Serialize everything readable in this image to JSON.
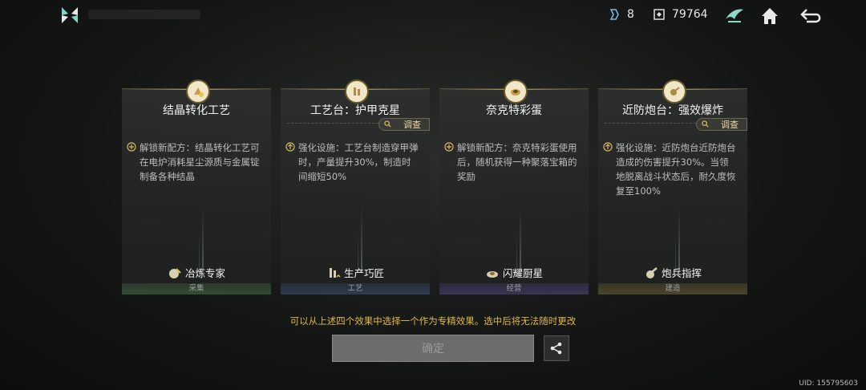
{
  "top": {
    "crystal_count": "8",
    "coin_count": "79764"
  },
  "cards": [
    {
      "title": "结晶转化工艺",
      "has_inspect": false,
      "desc": "解锁新配方：结晶转化工艺可在电炉消耗星尘源质与金属锭制备各种结晶",
      "skill": "冶炼专家",
      "category": "采集",
      "band": "green"
    },
    {
      "title": "工艺台：护甲克星",
      "has_inspect": true,
      "desc": "强化设施：工艺台制造穿甲弹时，产量提升30%，制造时间缩短50%",
      "skill": "生产巧匠",
      "category": "工艺",
      "band": "blue"
    },
    {
      "title": "奈克特彩蛋",
      "has_inspect": false,
      "desc": "解锁新配方：奈克特彩蛋使用后，随机获得一种聚落宝箱的奖励",
      "skill": "闪耀厨星",
      "category": "经营",
      "band": "purple"
    },
    {
      "title": "近防炮台：强效爆炸",
      "has_inspect": true,
      "desc": "强化设施：近防炮台近防炮台造成的伤害提升30%。当领地脱离战斗状态后，耐久度恢复至100%",
      "skill": "炮兵指挥",
      "category": "建造",
      "band": "gold"
    }
  ],
  "inspect_label": "调查",
  "hint": "可以从上述四个效果中选择一个作为专精效果。选中后将无法随时更改",
  "confirm_label": "确定",
  "uid": "UID: 155795603"
}
